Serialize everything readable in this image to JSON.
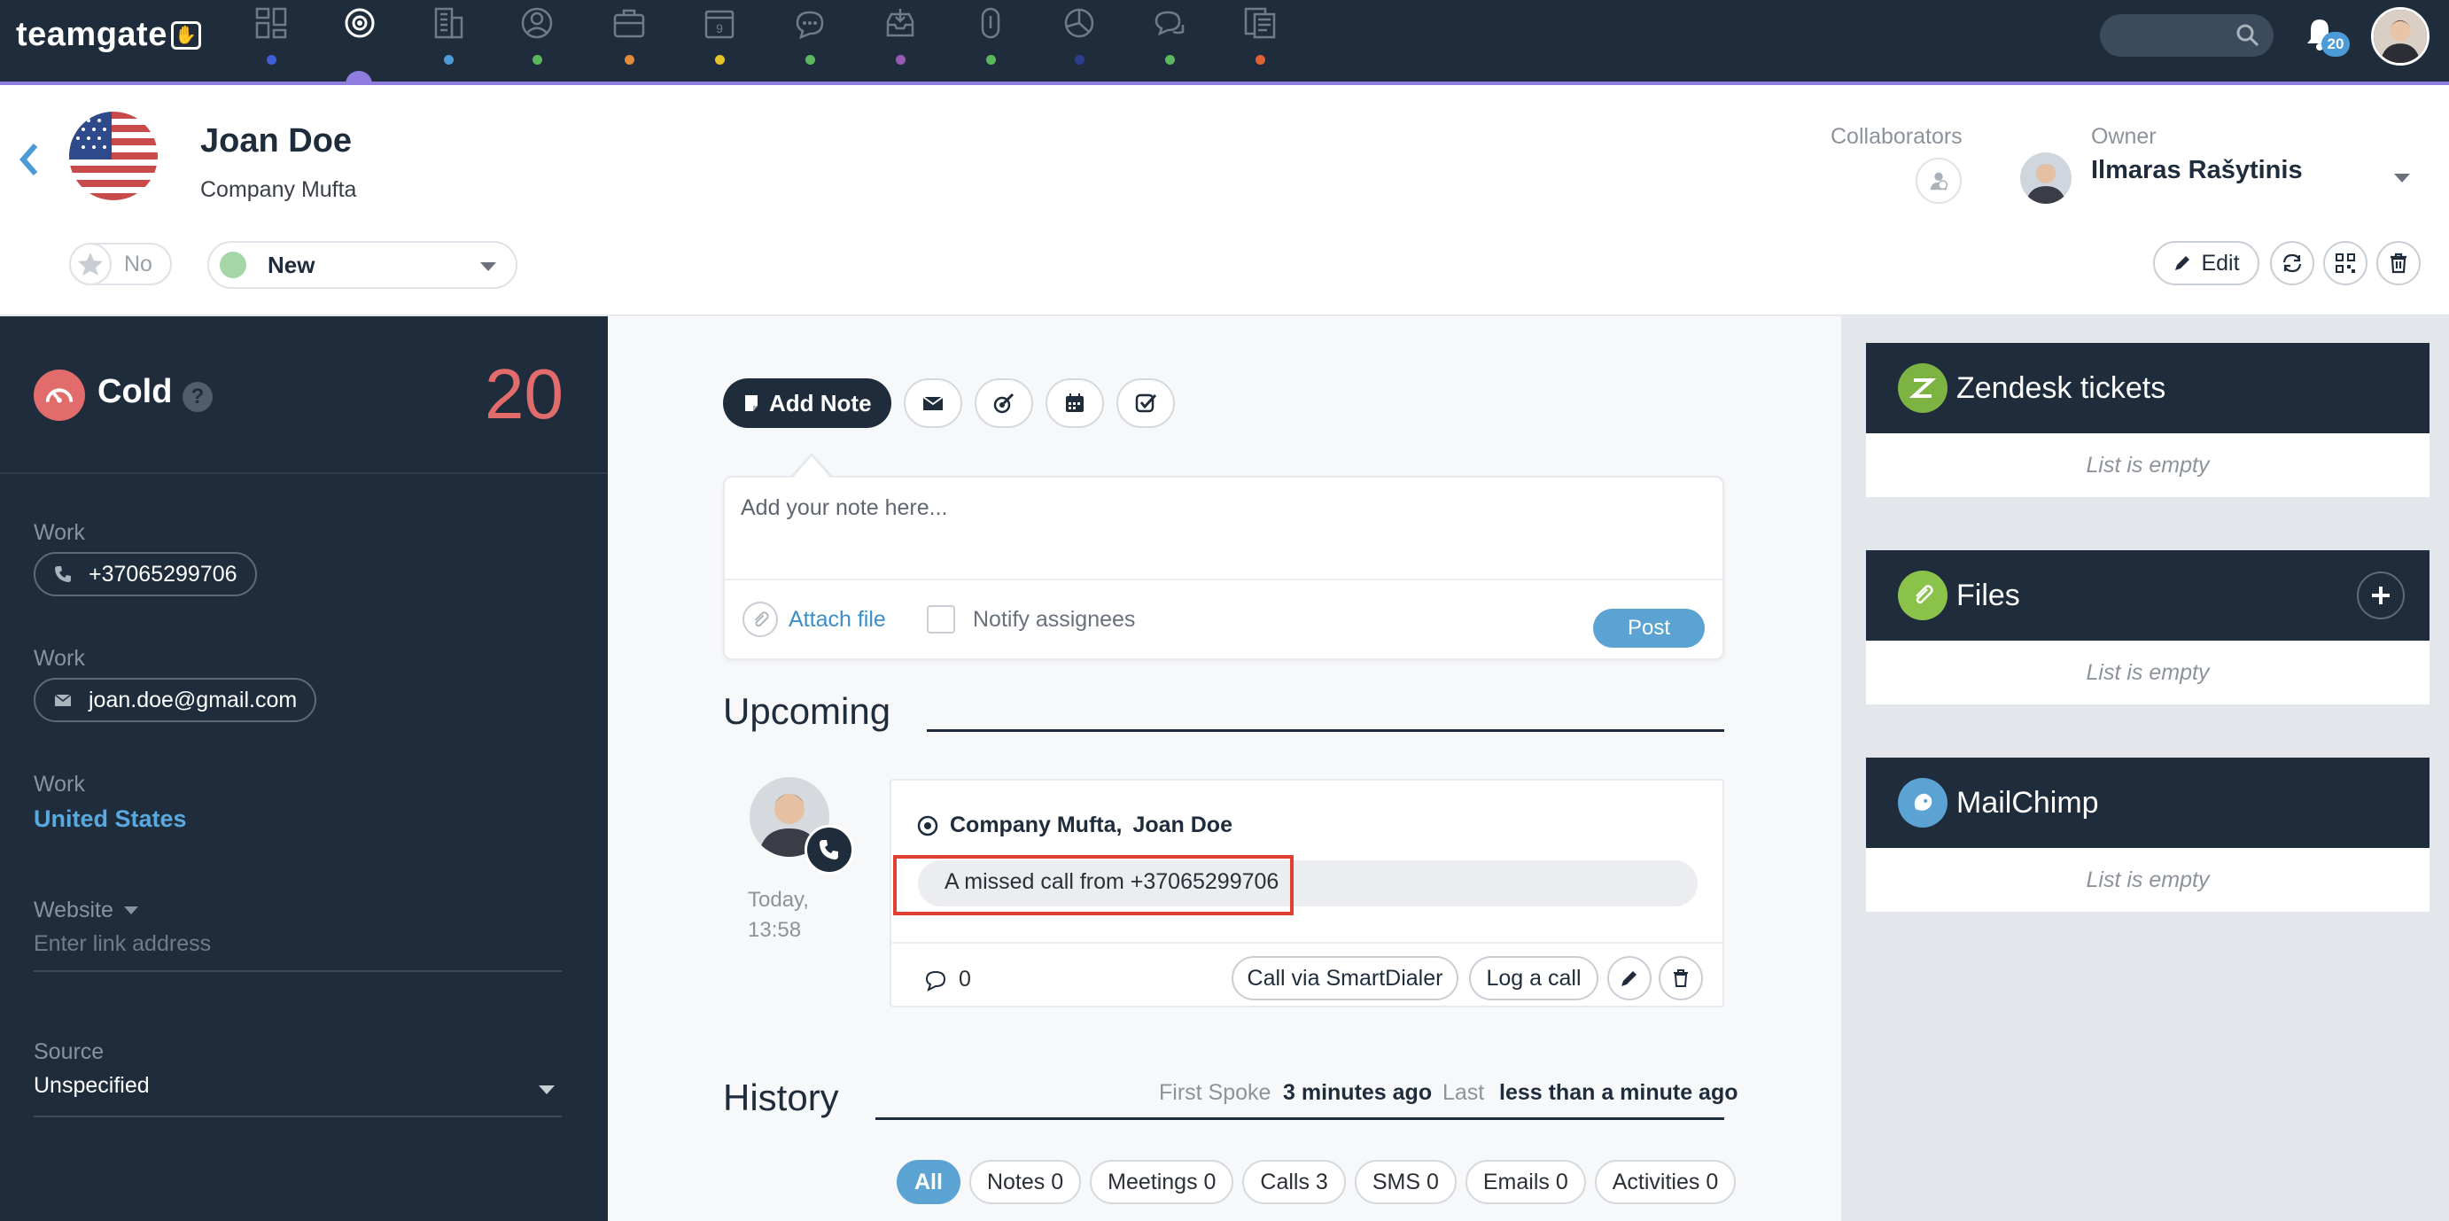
{
  "app": {
    "logo_text": "teamgate",
    "notification_count": "20",
    "nav_icons": [
      {
        "name": "dashboard-icon",
        "dot": "#3f5fd6"
      },
      {
        "name": "target-icon",
        "dot": "#8f7ee0"
      },
      {
        "name": "building-icon",
        "dot": "#4a9bd6"
      },
      {
        "name": "person-icon",
        "dot": "#5cb85c"
      },
      {
        "name": "briefcase-icon",
        "dot": "#e08a3c"
      },
      {
        "name": "calendar-icon",
        "dot": "#e6c229"
      },
      {
        "name": "chat-icon",
        "dot": "#5cb85c"
      },
      {
        "name": "inbox-icon",
        "dot": "#9b59b6"
      },
      {
        "name": "paperclip-icon",
        "dot": "#5cb85c"
      },
      {
        "name": "pie-chart-icon",
        "dot": "#2c3e8c"
      },
      {
        "name": "comments-icon",
        "dot": "#5cb85c"
      },
      {
        "name": "report-icon",
        "dot": "#e0602f"
      }
    ]
  },
  "contact": {
    "name": "Joan Doe",
    "company": "Company Mufta",
    "favorite_label": "No",
    "status": "New",
    "collaborators_label": "Collaborators",
    "owner_label": "Owner",
    "owner_name": "Ilmaras Rašytinis",
    "edit_label": "Edit"
  },
  "left_panel": {
    "temperature": "Cold",
    "help": "?",
    "score": "20",
    "phone_label": "Work",
    "phone": "+37065299706",
    "email_label": "Work",
    "email": "joan.doe@gmail.com",
    "address_label": "Work",
    "country": "United States",
    "website_label": "Website",
    "website_placeholder": "Enter link address",
    "source_label": "Source",
    "source_value": "Unspecified"
  },
  "center": {
    "add_note_label": "Add Note",
    "note_placeholder": "Add your note here...",
    "attach_label": "Attach file",
    "notify_label": "Notify assignees",
    "post_label": "Post",
    "upcoming_title": "Upcoming",
    "event": {
      "time_day": "Today,",
      "time_hour": "13:58",
      "title_company": "Company Mufta,",
      "title_person": "Joan Doe",
      "message": "A missed call from +37065299706",
      "comment_count": "0",
      "call_button": "Call via SmartDialer",
      "log_button": "Log a call"
    },
    "history_title": "History",
    "first_spoke_label": "First Spoke",
    "first_spoke_value": "3 minutes ago",
    "last_label": "Last",
    "last_value": "less than a minute ago",
    "filters": [
      {
        "label": "All",
        "active": true
      },
      {
        "label": "Notes 0"
      },
      {
        "label": "Meetings 0"
      },
      {
        "label": "Calls 3"
      },
      {
        "label": "SMS 0"
      },
      {
        "label": "Emails 0"
      },
      {
        "label": "Activities 0"
      }
    ]
  },
  "right_panel": {
    "widgets": [
      {
        "title": "Zendesk tickets",
        "empty": "List is empty",
        "color": "#7cb342"
      },
      {
        "title": "Files",
        "empty": "List is empty",
        "color": "#8bc34a"
      },
      {
        "title": "MailChimp",
        "empty": "List is empty",
        "color": "#5aa3d3"
      }
    ]
  },
  "colors": {
    "navy": "#1f2c3b",
    "accent": "#8f7ee0",
    "cold": "#e26b6b",
    "link": "#3b8fcb",
    "highlight": "#e0402f"
  }
}
